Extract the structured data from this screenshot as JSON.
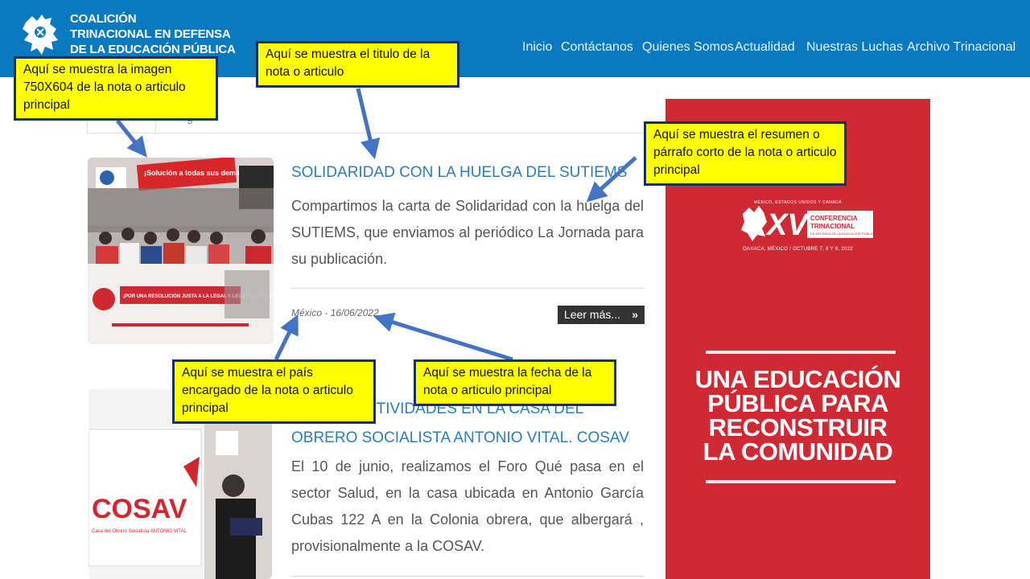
{
  "brand": {
    "lines": [
      "COALICIÓN",
      "TRINACIONAL EN DEFENSA",
      "DE LA EDUCACIÓN PÚBLICA"
    ]
  },
  "nav": {
    "items": [
      "Inicio",
      "Contáctanos",
      "Quienes Somos",
      "Actualidad",
      "Nuestras Luchas",
      "Archivo Trinacional"
    ]
  },
  "tabs": {
    "second_label": "g"
  },
  "articles": [
    {
      "title": "SOLIDARIDAD CON LA HUELGA DEL SUTIEMS",
      "summary": "Compartimos la carta de Solidaridad con la huelga del SUTIEMS, que enviamos al periódico La Jornada para su publicación.",
      "meta": "México - 16/06/2022",
      "read_more": "Leer más...",
      "image_text": {
        "banner_top": "¡Solución a todas sus demandas!",
        "banner_bottom": "¡POR UNA RESOLUCIÓN JUSTA A LA LEGAL Y LEGÍTIMA HUELGA DEL SUTIEMS!"
      }
    },
    {
      "title": "…O LAS ACTIVIDADES EN LA CASA DEL OBRERO SOCIALISTA ANTONIO VITAL. COSAV",
      "summary": "El 10 de junio, realizamos el Foro Qué pasa en el sector Salud, en la casa ubicada en Antonio García Cubas 122 A en la Colonia obrera, que albergará , provisionalmente a la COSAV.",
      "image_text": {
        "logo": "COSAV",
        "caption": "Casa del Obrero Socialista ANTONIO VITAL"
      }
    }
  ],
  "poster": {
    "head": "MÉXICO, ESTADOS UNIDOS Y CANADÁ",
    "conference": "XV CONFERENCIA TRINACIONAL",
    "conference_sub": "EN DEFENSA DE LA EDUCACIÓN PÚBLICA",
    "place": "OAXACA, MÉXICO / OCTUBRE 7, 8 Y 9, 2022",
    "slogan": [
      "UNA EDUCACIÓN",
      "PÚBLICA PARA",
      "RECONSTRUIR",
      "LA COMUNIDAD"
    ]
  },
  "callouts": {
    "image": "Aquí se muestra la imagen 750X604 de la nota o articulo principal",
    "title": "Aquí se muestra el titulo  de la nota o articulo",
    "summary": "Aquí se muestra el resumen o párrafo corto de la nota o articulo principal",
    "country": "Aquí se muestra el país encargado de la nota o articulo principal",
    "date": "Aquí se muestra la fecha de la nota o articulo principal"
  },
  "colors": {
    "header": "#0b79bf",
    "title_link": "#2a7db7",
    "poster_red": "#cf2a34",
    "callout_fill": "#ffff00",
    "callout_border": "#17325c",
    "arrow": "#4472c4"
  }
}
